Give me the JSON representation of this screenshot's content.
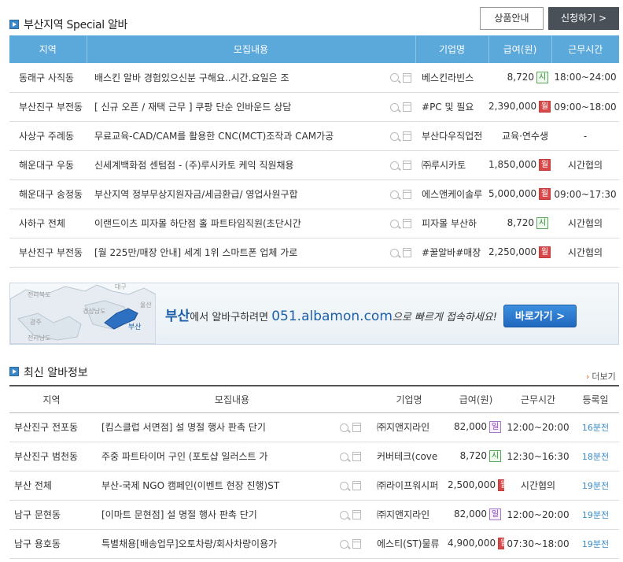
{
  "special": {
    "title": "부산지역 Special 알바",
    "buttons": {
      "product_info": "상품안내",
      "apply": "신청하기 >"
    },
    "columns": [
      "지역",
      "모집내용",
      "기업명",
      "급여(원)",
      "근무시간"
    ],
    "rows": [
      {
        "area": "동래구 사직동",
        "title": "배스킨 알바 경험있으신분 구해요..시간.요일은 조",
        "company": "베스킨라빈스",
        "pay": "8,720",
        "pay_type": "시",
        "time": "18:00~24:00"
      },
      {
        "area": "부산진구 부전동",
        "title": "[ 신규 오픈 / 재택 근무 ] 쿠팡 단순 인바운드 상담",
        "company": "#PC 및 필요",
        "pay": "2,390,000",
        "pay_type": "월",
        "time": "09:00~18:00"
      },
      {
        "area": "사상구 주례동",
        "title": "무료교육-CAD/CAM를 활용한 CNC(MCT)조작과 CAM가공",
        "company": "부산다우직업전",
        "pay": "교육·연수생",
        "pay_type": "",
        "time": "-"
      },
      {
        "area": "해운대구 우동",
        "title": "신세계백화점 센텀점 - (주)루시카토 케익 직원채용",
        "company": "㈜루시카토",
        "pay": "1,850,000",
        "pay_type": "월",
        "time": "시간협의"
      },
      {
        "area": "해운대구 송정동",
        "title": "부산지역 정부무상지원자금/세금환급/ 영업사원구합",
        "company": "에스앤케이솔루",
        "pay": "5,000,000",
        "pay_type": "월",
        "time": "09:00~17:30"
      },
      {
        "area": "사하구 전체",
        "title": "이랜드이츠 피자몰 하단점 홀 파트타임직원(초단시간",
        "company": "피자몰 부산하",
        "pay": "8,720",
        "pay_type": "시",
        "time": "시간협의"
      },
      {
        "area": "부산진구 부전동",
        "title": "[월 225만/매장 안내] 세계 1위 스마트폰 업체 가로",
        "company": "#꿀알바#매장",
        "pay": "2,250,000",
        "pay_type": "월",
        "time": "시간협의"
      }
    ]
  },
  "banner": {
    "map_labels": [
      "전라북도",
      "대구",
      "경상남도",
      "울산",
      "광주",
      "부산",
      "전라남도"
    ],
    "city": "부산",
    "text_mid": "에서 알바구하려면 ",
    "phone": "051.albamon.com",
    "text_tail": "으로 빠르게 접속하세요!",
    "button": "바로가기 >"
  },
  "recent": {
    "title": "최신 알바정보",
    "more": "더보기",
    "columns": [
      "지역",
      "모집내용",
      "기업명",
      "급여(원)",
      "근무시간",
      "등록일"
    ],
    "rows": [
      {
        "area": "부산진구 전포동",
        "title": "[킴스클럽 서면점] 설 명절 행사 판촉 단기",
        "company": "㈜지앤지라인",
        "pay": "82,000",
        "pay_type": "일",
        "time": "12:00~20:00",
        "reg": "16분전"
      },
      {
        "area": "부산진구 범천동",
        "title": "주중 파트타이머 구인 (포토샵 일러스트 가",
        "company": "커버테크(cove",
        "pay": "8,720",
        "pay_type": "시",
        "time": "12:30~16:30",
        "reg": "18분전"
      },
      {
        "area": "부산 전체",
        "title": "부산-국제 NGO 캠페인(이벤트 현장 진행)ST",
        "company": "㈜라이프워시퍼",
        "pay": "2,500,000",
        "pay_type": "월",
        "time": "시간협의",
        "reg": "19분전"
      },
      {
        "area": "남구 문현동",
        "title": "[이마트 문현점] 설 명절 행사 판촉 단기",
        "company": "㈜지앤지라인",
        "pay": "82,000",
        "pay_type": "일",
        "time": "12:00~20:00",
        "reg": "19분전"
      },
      {
        "area": "남구 용호동",
        "title": "특별채용[배송업무]오토차량/회사차량이용가",
        "company": "에스티(ST)물류",
        "pay": "4,900,000",
        "pay_type": "월",
        "time": "07:30~18:00",
        "reg": "19분전"
      }
    ]
  }
}
